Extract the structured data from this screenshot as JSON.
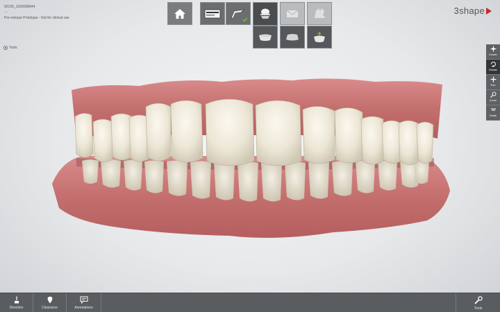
{
  "case": {
    "id": "92105_1026008044",
    "sub": "- -",
    "notice": "Pre-release Prototype - Not for clinical use"
  },
  "brand": {
    "name": "3shape",
    "accent": "#c62828"
  },
  "top_toolbar": {
    "buttons": [
      {
        "icon": "home-icon"
      },
      {
        "icon": "order-form-icon"
      },
      {
        "icon": "scan-tray-icon",
        "status": "done"
      },
      {
        "icon": "bite-scan-icon",
        "state": "active"
      },
      {
        "icon": "envelope-icon",
        "state": "disabled"
      },
      {
        "icon": "articulator-icon",
        "state": "disabled"
      }
    ],
    "sub_buttons": [
      {
        "icon": "lower-jaw-icon"
      },
      {
        "icon": "upper-jaw-icon"
      },
      {
        "icon": "jaw-add-icon",
        "status": "done"
      }
    ],
    "check_color": "#6bbf2a"
  },
  "tools_toggle": {
    "label": "Tools"
  },
  "nav_panel": {
    "buttons": [
      {
        "label": "Center",
        "icon": "center-icon"
      },
      {
        "label": "Rotate",
        "icon": "rotate-icon",
        "state": "active"
      },
      {
        "label": "Pan",
        "icon": "pan-icon"
      },
      {
        "label": "Zoom",
        "icon": "zoom-icon"
      },
      {
        "label": "Detail",
        "icon": "detail-icon"
      }
    ]
  },
  "bottom_bar": {
    "left": [
      {
        "label": "Direction",
        "icon": "direction-icon"
      },
      {
        "label": "Clearance",
        "icon": "clearance-icon"
      },
      {
        "label": "Annotations",
        "icon": "annotations-icon"
      }
    ],
    "right": {
      "label": "Tools",
      "icon": "wrench-icon"
    }
  }
}
